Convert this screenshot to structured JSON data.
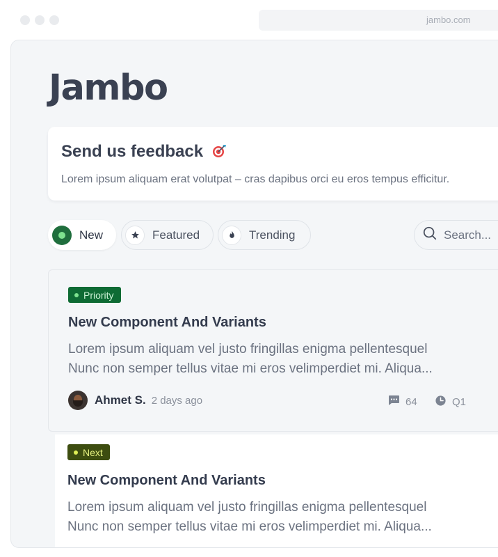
{
  "browser": {
    "url": "jambo.com"
  },
  "app": {
    "title": "Jambo"
  },
  "feedback": {
    "title": "Send us feedback",
    "icon": "target-icon",
    "text": "Lorem ipsum aliquam erat volutpat – cras dapibus orci eu eros tempus efficitur."
  },
  "tabs": [
    {
      "label": "New",
      "icon": "radio-dot-icon",
      "active": true
    },
    {
      "label": "Featured",
      "icon": "star-icon",
      "active": false
    },
    {
      "label": "Trending",
      "icon": "flame-icon",
      "active": false
    }
  ],
  "search": {
    "placeholder": "Search..."
  },
  "posts": [
    {
      "badge": "Priority",
      "badge_color": "#0e6b34",
      "title": "New Component And Variants",
      "body_line1": "Lorem ipsum aliquam vel justo fringillas enigma pellentesquel",
      "body_line2": "Nunc non semper tellus vitae mi eros velimperdiet mi. Aliqua...",
      "author": "Ahmet S.",
      "time": "2 days ago",
      "comments": "64",
      "quarter": "Q1"
    },
    {
      "badge": "Next",
      "badge_color": "#3d4d10",
      "title": "New Component And Variants",
      "body_line1": "Lorem ipsum aliquam vel justo fringillas enigma pellentesquel",
      "body_line2": "Nunc non semper tellus vitae mi eros velimperdiet mi. Aliqua..."
    }
  ]
}
